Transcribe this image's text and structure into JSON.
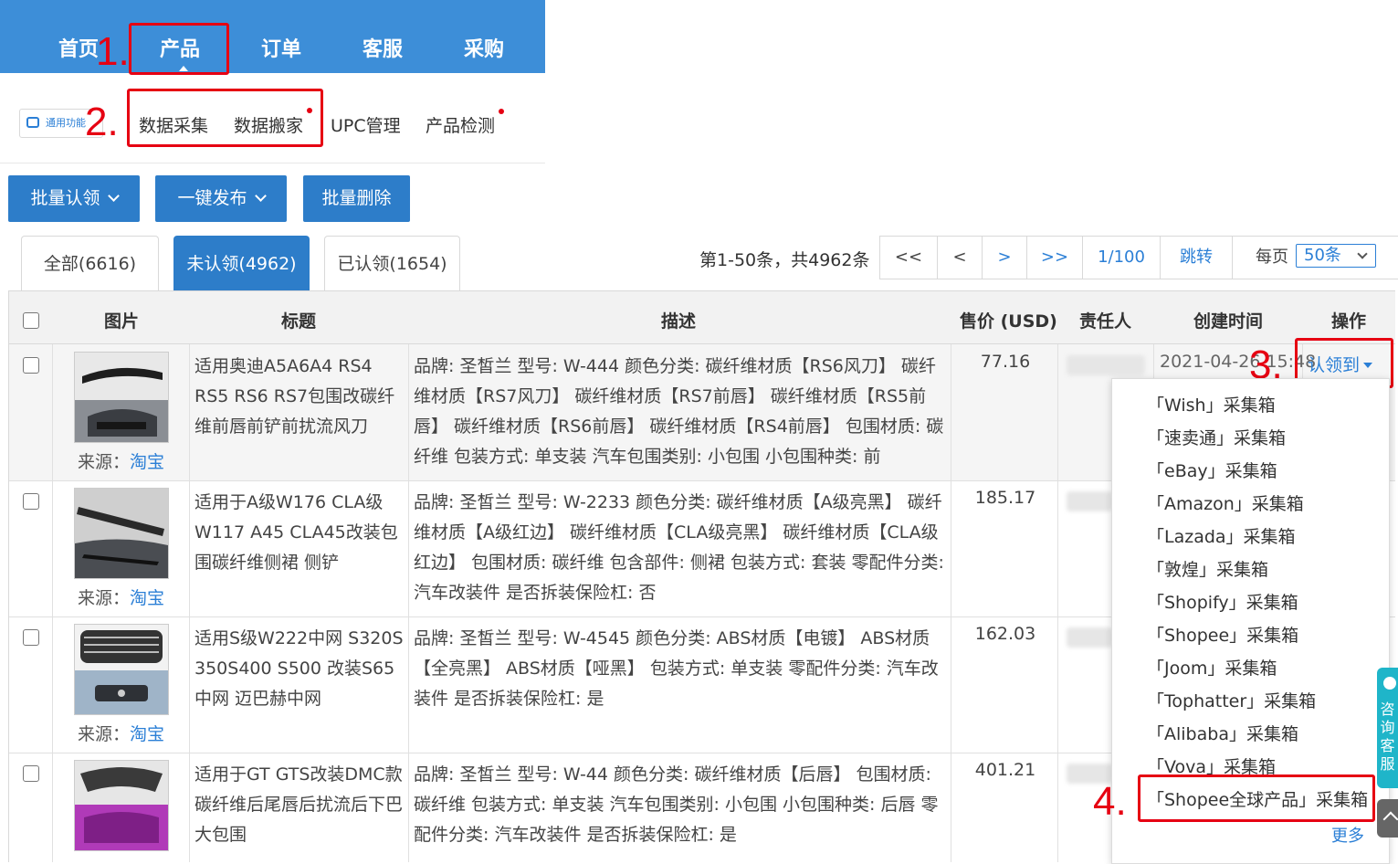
{
  "nav": {
    "items": [
      "首页",
      "产品",
      "订单",
      "客服",
      "采购"
    ]
  },
  "subnav": {
    "tool_label": "通用功能",
    "items": [
      "数据采集",
      "数据搬家",
      "UPC管理",
      "产品检测"
    ]
  },
  "actions": {
    "batch_claim": "批量认领",
    "one_click_publish": "一键发布",
    "batch_delete": "批量删除"
  },
  "tabs": {
    "all": "全部(6616)",
    "unclaimed": "未认领(4962)",
    "claimed": "已认领(1654)"
  },
  "pagination": {
    "info": "第1-50条，共4962条",
    "first": "<<",
    "prev": "<",
    "next": ">",
    "last": ">>",
    "current": "1/100",
    "jump": "跳转",
    "per_page_label": "每页",
    "per_page_value": "50条"
  },
  "table": {
    "headers": {
      "image": "图片",
      "title": "标题",
      "desc": "描述",
      "price": "售价 (USD)",
      "owner": "责任人",
      "created": "创建时间",
      "action": "操作"
    },
    "source_label": "来源：",
    "rows": [
      {
        "title": "适用奥迪A5A6A4 RS4 RS5 RS6 RS7包围改碳纤维前唇前铲前扰流风刀",
        "desc": "品牌: 圣皙兰 型号: W-444 颜色分类: 碳纤维材质【RS6风刀】 碳纤维材质【RS7风刀】 碳纤维材质【RS7前唇】 碳纤维材质【RS5前唇】 碳纤维材质【RS6前唇】 碳纤维材质【RS4前唇】 包围材质: 碳纤维 包装方式: 单支装 汽车包围类别: 小包围 小包围种类: 前",
        "price": "77.16",
        "source": "淘宝",
        "created": "2021-04-26 15:48"
      },
      {
        "title": "适用于A级W176 CLA级W117 A45 CLA45改装包围碳纤维侧裙 侧铲",
        "desc": "品牌: 圣皙兰 型号: W-2233 颜色分类: 碳纤维材质【A级亮黑】 碳纤维材质【A级红边】 碳纤维材质【CLA级亮黑】 碳纤维材质【CLA级红边】 包围材质: 碳纤维 包含部件: 侧裙 包装方式: 套装 零配件分类: 汽车改装件 是否拆装保险杠: 否",
        "price": "185.17",
        "source": "淘宝"
      },
      {
        "title": "适用S级W222中网 S320S 350S400 S500 改装S65中网 迈巴赫中网",
        "desc": "品牌: 圣皙兰 型号: W-4545 颜色分类: ABS材质【电镀】 ABS材质【全亮黑】 ABS材质【哑黑】 包装方式: 单支装 零配件分类: 汽车改装件 是否拆装保险杠: 是",
        "price": "162.03",
        "source": "淘宝"
      },
      {
        "title": "适用于GT GTS改装DMC款碳纤维后尾唇后扰流后下巴大包围",
        "desc": "品牌: 圣皙兰 型号: W-44 颜色分类: 碳纤维材质【后唇】 包围材质: 碳纤维 包装方式: 单支装 汽车包围类别: 小包围 小包围种类: 后唇 零配件分类: 汽车改装件 是否拆装保险杠: 是",
        "price": "401.21",
        "source": "淘宝"
      }
    ]
  },
  "claim": {
    "button": "认领到",
    "options": [
      "「Wish」采集箱",
      "「速卖通」采集箱",
      "「eBay」采集箱",
      "「Amazon」采集箱",
      "「Lazada」采集箱",
      "「敦煌」采集箱",
      "「Shopify」采集箱",
      "「Shopee」采集箱",
      "「Joom」采集箱",
      "「Tophatter」采集箱",
      "「Alibaba」采集箱",
      "「Vova」采集箱",
      "「Shopee全球产品」采集箱"
    ],
    "more": "更多"
  },
  "annotations": [
    "1.",
    "2.",
    "3.",
    "4."
  ],
  "float": {
    "consult": "咨询客服"
  },
  "colors": {
    "primary": "#2d7dc9",
    "nav_bg": "#3d8ed8",
    "annotation": "#e60012",
    "link": "#2b7fd6"
  }
}
